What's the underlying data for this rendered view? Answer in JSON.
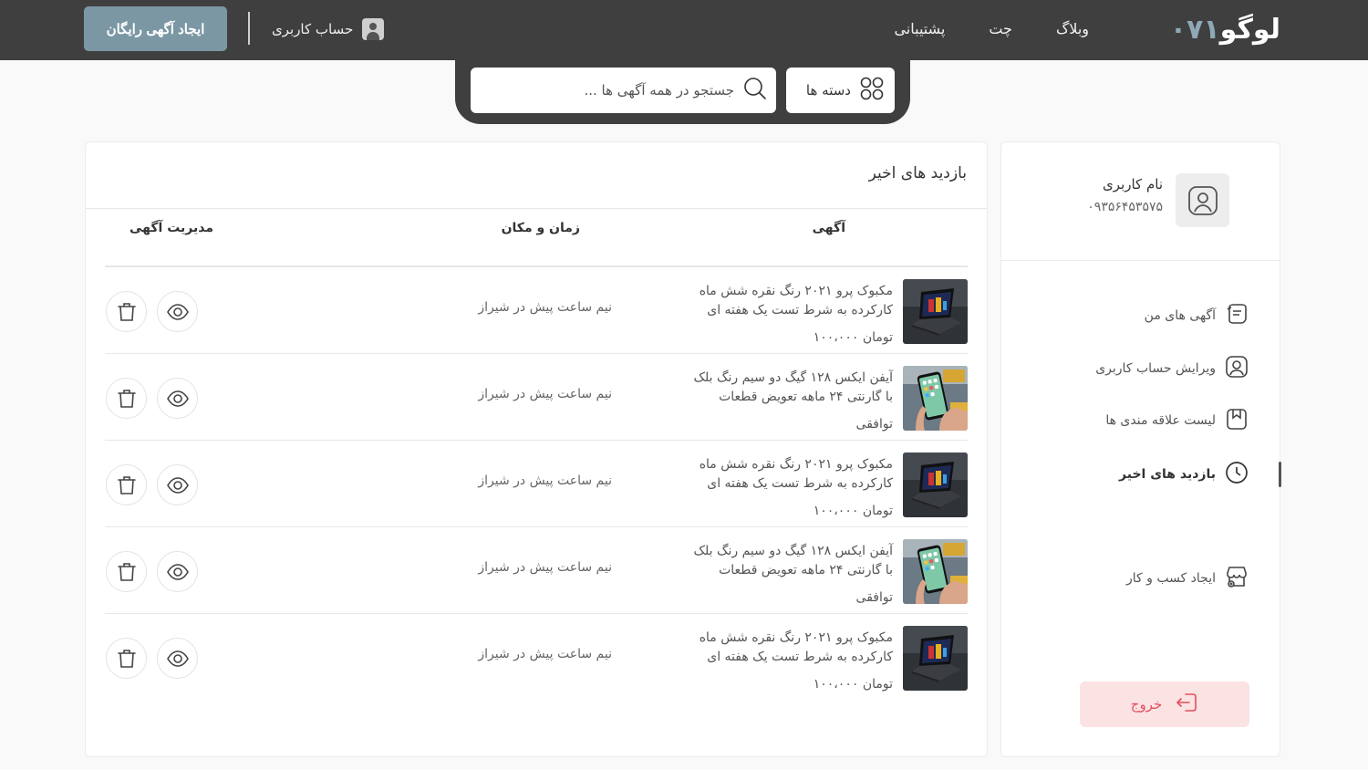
{
  "header": {
    "logo_text": "لوگو",
    "logo_number": "۰۷۱",
    "nav": [
      "وبلاگ",
      "چت",
      "پشتیبانی"
    ],
    "account_label": "حساب کاربری",
    "create_ad_label": "ایجاد آگهی رایگان"
  },
  "search": {
    "placeholder": "جستجو در همه آگهی ها ...",
    "categories_label": "دسته ها"
  },
  "profile": {
    "name": "نام کاربری",
    "phone": "۰۹۳۵۶۴۵۳۵۷۵"
  },
  "sidebar": {
    "items": [
      {
        "label": "آگهی های من",
        "icon": "ads-icon"
      },
      {
        "label": "ویرایش حساب کاربری",
        "icon": "user-icon"
      },
      {
        "label": "لیست علاقه مندی ها",
        "icon": "bookmark-icon"
      },
      {
        "label": "بازدید های اخیر",
        "icon": "clock-icon",
        "active": true
      },
      {
        "label": "ایجاد کسب و کار",
        "icon": "store-icon"
      }
    ],
    "logout_label": "خروج"
  },
  "main": {
    "title": "بازدید های اخیر",
    "columns": [
      "آگهی",
      "زمان و مکان",
      "مدیریت آگهی"
    ],
    "rows": [
      {
        "line1": "مکبوک پرو ۲۰۲۱ رنگ نقره شش ماه",
        "line2": "کارکرده به شرط تست یک هفته ای",
        "price": "۱۰۰،۰۰۰ تومان",
        "time": "نیم ساعت پیش در شیراز",
        "image": "laptop"
      },
      {
        "line1": "آیفن ایکس ۱۲۸ گیگ دو سیم رنگ بلک",
        "line2": "با گارنتی ۲۴ ماهه تعویض قطعات",
        "price": "توافقی",
        "time": "نیم ساعت پیش در شیراز",
        "image": "phone"
      },
      {
        "line1": "مکبوک پرو ۲۰۲۱ رنگ نقره شش ماه",
        "line2": "کارکرده به شرط تست یک هفته ای",
        "price": "۱۰۰،۰۰۰ تومان",
        "time": "نیم ساعت پیش در شیراز",
        "image": "laptop"
      },
      {
        "line1": "آیفن ایکس ۱۲۸ گیگ دو سیم رنگ بلک",
        "line2": "با گارنتی ۲۴ ماهه تعویض قطعات",
        "price": "توافقی",
        "time": "نیم ساعت پیش در شیراز",
        "image": "phone"
      },
      {
        "line1": "مکبوک پرو ۲۰۲۱ رنگ نقره شش ماه",
        "line2": "کارکرده به شرط تست یک هفته ای",
        "price": "۱۰۰،۰۰۰ تومان",
        "time": "نیم ساعت پیش در شیراز",
        "image": "laptop"
      }
    ]
  },
  "colors": {
    "header_bg": "#3f3f40",
    "accent": "#7b97a4",
    "logout_bg": "#fbe2e3",
    "logout_text": "#e0505c"
  }
}
